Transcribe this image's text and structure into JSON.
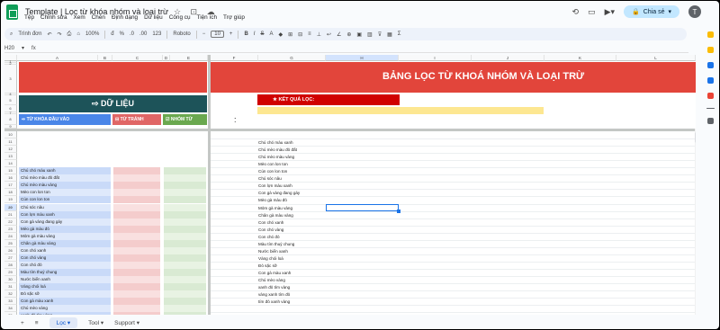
{
  "app": {
    "doc_title": "Template | Lọc từ khóa nhóm và loại trừ",
    "menu": [
      "Tệp",
      "Chỉnh sửa",
      "Xem",
      "Chèn",
      "Định dạng",
      "Dữ liệu",
      "Công cụ",
      "Tiện ích",
      "Trợ giúp"
    ],
    "share_label": "Chia sẻ",
    "avatar_letter": "T"
  },
  "toolbar": {
    "search_label": "Trình đơn",
    "zoom": "100%",
    "currency": "đ",
    "percent": "%",
    "decimals_dec": ".0",
    "decimals_inc": ".00",
    "number_format": "123",
    "font": "Roboto",
    "font_size": "10"
  },
  "formula_bar": {
    "cell_ref": "H20",
    "fx": "fx"
  },
  "columns": [
    "A",
    "B",
    "C",
    "D",
    "E",
    "F",
    "G",
    "H",
    "I",
    "J",
    "K",
    "L"
  ],
  "row_numbers_top": [
    "1",
    "2",
    "3",
    "4",
    "5",
    "6",
    "7",
    "8",
    "9"
  ],
  "row_numbers": [
    "10",
    "11",
    "12",
    "13",
    "14",
    "15",
    "16",
    "17",
    "18",
    "19",
    "20",
    "21",
    "22",
    "23",
    "24",
    "25",
    "26",
    "27",
    "28",
    "29",
    "30",
    "31",
    "32",
    "33",
    "34",
    "35",
    "36",
    "37"
  ],
  "sheet": {
    "data_title": "⇨ DỮ LIỆU",
    "hdr_keyword": "⇨ TỪ KHÓA ĐẦU VÀO",
    "hdr_exclude": "⊟ TỪ TRÁNH",
    "hdr_group": "☑ NHÓM TỪ",
    "main_title": "BẢNG LỌC TỪ KHOÁ NHÓM VÀ LOẠI TRỪ",
    "result_label": "★ KẾT QUẢ LỌC:",
    "colon": ":"
  },
  "input_keywords": [
    "Chú chó màu xanh",
    "Chú mèo màu đỏ đất",
    "Chú mèo màu vàng",
    "Mèo con lon ton",
    "Cún con lon ton",
    "Chú sóc nâu",
    "Con lợn màu xanh",
    "Con gà vàng đang gáy",
    "Mèo gà màu đỏ",
    "Mỏm gà màu vàng",
    "Chân gà màu vàng",
    "Con chó xanh",
    "Con chó vàng",
    "Con chó đỏ",
    "Màu tím thuỷ chung",
    "Nước biển xanh",
    "Vàng chói loá",
    "Đỏ sặc sỡ",
    "Con gà màu xanh",
    "Chú mèo vàng",
    "xanh đỏ tím vàng",
    "vàng xanh tím đỏ",
    "tím đỏ xanh vàng"
  ],
  "results": [
    "Chú chó màu xanh",
    "Chú mèo màu đỏ đất",
    "Chú mèo màu vàng",
    "Mèo con lon ton",
    "Cún con lon ton",
    "Chú sóc nâu",
    "Con lợn màu xanh",
    "Con gà vàng đang gáy",
    "Mèo gà màu đỏ",
    "Mỏm gà màu vàng",
    "Chân gà màu vàng",
    "Con chó xanh",
    "Con chó vàng",
    "Con chó đỏ",
    "Màu tím thuỷ chung",
    "Nước biển xanh",
    "Vàng chói loá",
    "Đỏ sặc sỡ",
    "Con gà màu xanh",
    "Chú mèo vàng",
    "xanh đỏ tím vàng",
    "vàng xanh tím đỏ",
    "tím đỏ xanh vàng"
  ],
  "tabs": {
    "add": "+",
    "list": "≡",
    "items": [
      "Lọc ▾",
      "Tool ▾",
      "Support ▾"
    ]
  },
  "colors": {
    "banner_red": "#e2453b",
    "data_teal": "#1d5359",
    "keyword_blue": "#4a86e8",
    "exclude_red": "#e06666",
    "group_green": "#6aa84f",
    "result_red": "#d00000",
    "yellow": "#fde791"
  }
}
